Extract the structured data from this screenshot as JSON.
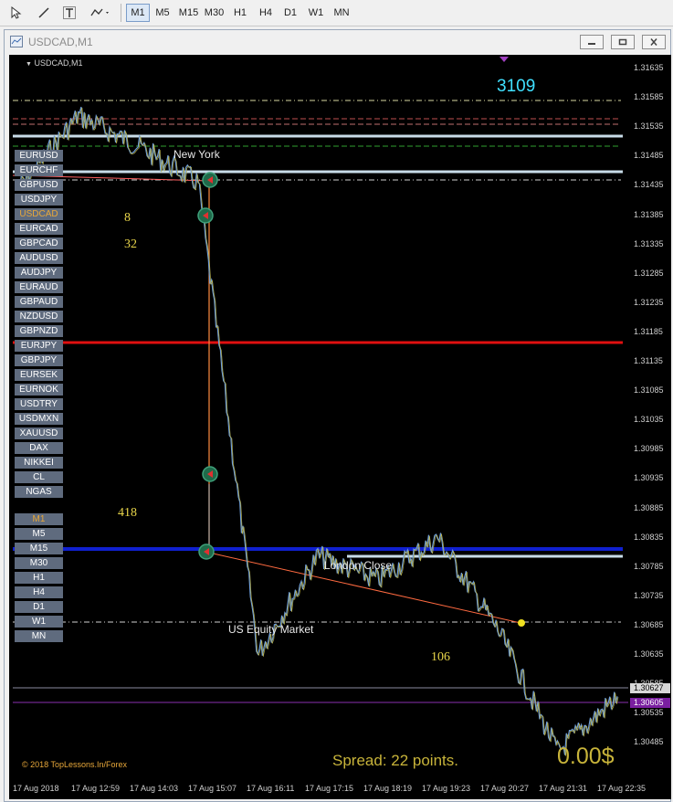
{
  "toolbar": {
    "timeframes": [
      "M1",
      "M5",
      "M15",
      "M30",
      "H1",
      "H4",
      "D1",
      "W1",
      "MN"
    ],
    "active_timeframe": "M1"
  },
  "window": {
    "title": "USDCAD,M1"
  },
  "chart": {
    "symbol_label": "USDCAD,M1",
    "counter_top": "3109",
    "num_8": "8",
    "num_32": "32",
    "num_418": "418",
    "num_106": "106",
    "session_new_york": "New York",
    "session_london_close": "London Close",
    "session_us_equity": "US Equity Market",
    "spread_text": "Spread: 22 points.",
    "profit_text": "0.00$",
    "copyright": "© 2018 TopLessons.In/Forex",
    "colors": {
      "background": "#000000",
      "red_line": "#e01010",
      "blue_line": "#1020d0",
      "white_line": "#c8dce8",
      "counter": "#40e0ff",
      "gold": "#c8b43a",
      "orange": "#ff8c40"
    }
  },
  "symbols": [
    "EURUSD",
    "EURCHF",
    "GBPUSD",
    "USDJPY",
    "USDCAD",
    "EURCAD",
    "GBPCAD",
    "AUDUSD",
    "AUDJPY",
    "EURAUD",
    "GBPAUD",
    "NZDUSD",
    "GBPNZD",
    "EURJPY",
    "GBPJPY",
    "EURSEK",
    "EURNOK",
    "USDTRY",
    "USDMXN",
    "XAUUSD",
    "DAX",
    "NIKKEI",
    "CL",
    "NGAS"
  ],
  "active_symbol": "USDCAD",
  "tf_panel": [
    "M1",
    "M5",
    "M15",
    "M30",
    "H1",
    "H4",
    "D1",
    "W1",
    "MN"
  ],
  "active_tf_panel": "M1",
  "price_axis": {
    "labels": [
      "1.31635",
      "1.31585",
      "1.31535",
      "1.31485",
      "1.31435",
      "1.31385",
      "1.31335",
      "1.31285",
      "1.31235",
      "1.31185",
      "1.31135",
      "1.31085",
      "1.31035",
      "1.30985",
      "1.30935",
      "1.30885",
      "1.30835",
      "1.30785",
      "1.30735",
      "1.30685",
      "1.30635",
      "1.30585",
      "1.30535",
      "1.30485"
    ],
    "box_upper": "1.30627",
    "box_lower": "1.30605"
  },
  "time_axis": {
    "labels": [
      "17 Aug 2018",
      "17 Aug 12:59",
      "17 Aug 14:03",
      "17 Aug 15:07",
      "17 Aug 16:11",
      "17 Aug 17:15",
      "17 Aug 18:19",
      "17 Aug 19:23",
      "17 Aug 20:27",
      "17 Aug 21:31",
      "17 Aug 22:35"
    ]
  },
  "chart_data": {
    "type": "line",
    "symbol": "USDCAD",
    "timeframe": "M1",
    "x": [
      "17 Aug 2018",
      "17 Aug 12:59",
      "17 Aug 14:03",
      "17 Aug 15:07",
      "17 Aug 16:11",
      "17 Aug 17:15",
      "17 Aug 18:19",
      "17 Aug 19:23",
      "17 Aug 20:27",
      "17 Aug 21:31",
      "17 Aug 22:35"
    ],
    "series": [
      {
        "name": "",
        "values": [
          1.3144,
          1.3156,
          1.3151,
          1.3145,
          1.3068,
          1.3084,
          1.308,
          1.3087,
          1.3072,
          1.3052,
          1.3061
        ]
      }
    ],
    "ylim": [
      1.30485,
      1.31635
    ],
    "horizontal_levels": [
      1.31185,
      1.30855,
      1.3053,
      1.31485
    ],
    "grid": false
  }
}
